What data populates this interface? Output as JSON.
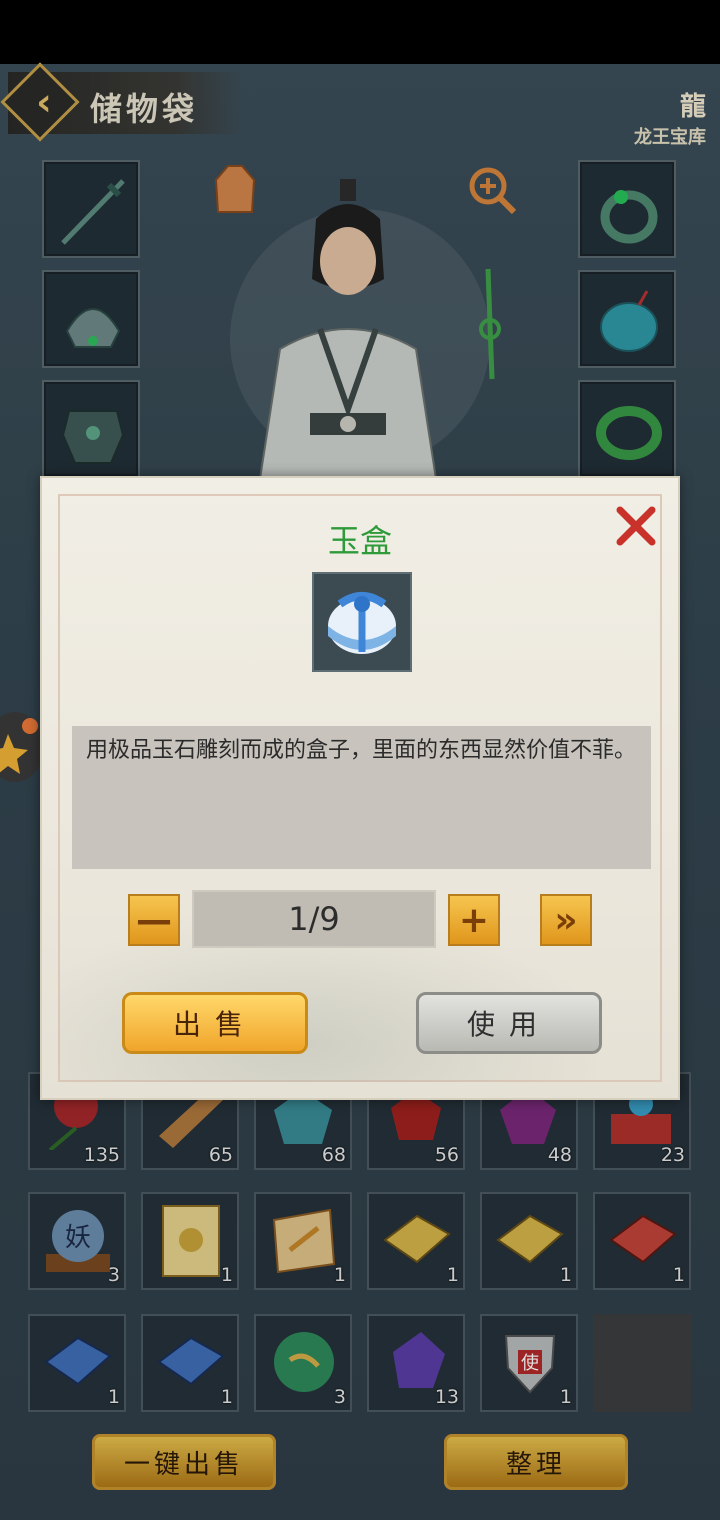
{
  "header": {
    "title": "储物袋",
    "logo_text": "龙王宝库"
  },
  "dialog": {
    "item_name": "玉盒",
    "description": "用极品玉石雕刻而成的盒子，里面的东西显然价值不菲。",
    "quantity": "1/9",
    "minus_label": "—",
    "plus_label": "+",
    "max_label": "»",
    "sell_label": "出售",
    "use_label": "使用",
    "colors": {
      "title": "#2e9a3a",
      "sell": "#f0a52a",
      "use": "#b9b9b4"
    }
  },
  "inventory": {
    "row1": [
      "135",
      "65",
      "68",
      "56",
      "48",
      "23"
    ],
    "row2": [
      "3",
      "1",
      "1",
      "1",
      "1",
      "1"
    ],
    "row3": [
      "1",
      "1",
      "3",
      "13",
      "1",
      ""
    ],
    "row2_icons": [
      "yao-orb-icon",
      "scroll-icon",
      "map-scroll-icon",
      "yellow-book-icon",
      "yellow-book-icon",
      "red-book-icon"
    ],
    "row3_icons": [
      "blue-book-icon",
      "blue-book-icon",
      "green-orb-icon",
      "purple-crystal-icon",
      "shield-badge-icon",
      "empty-slot"
    ]
  },
  "footer": {
    "sell_all_label": "一键出售",
    "sort_label": "整理"
  }
}
